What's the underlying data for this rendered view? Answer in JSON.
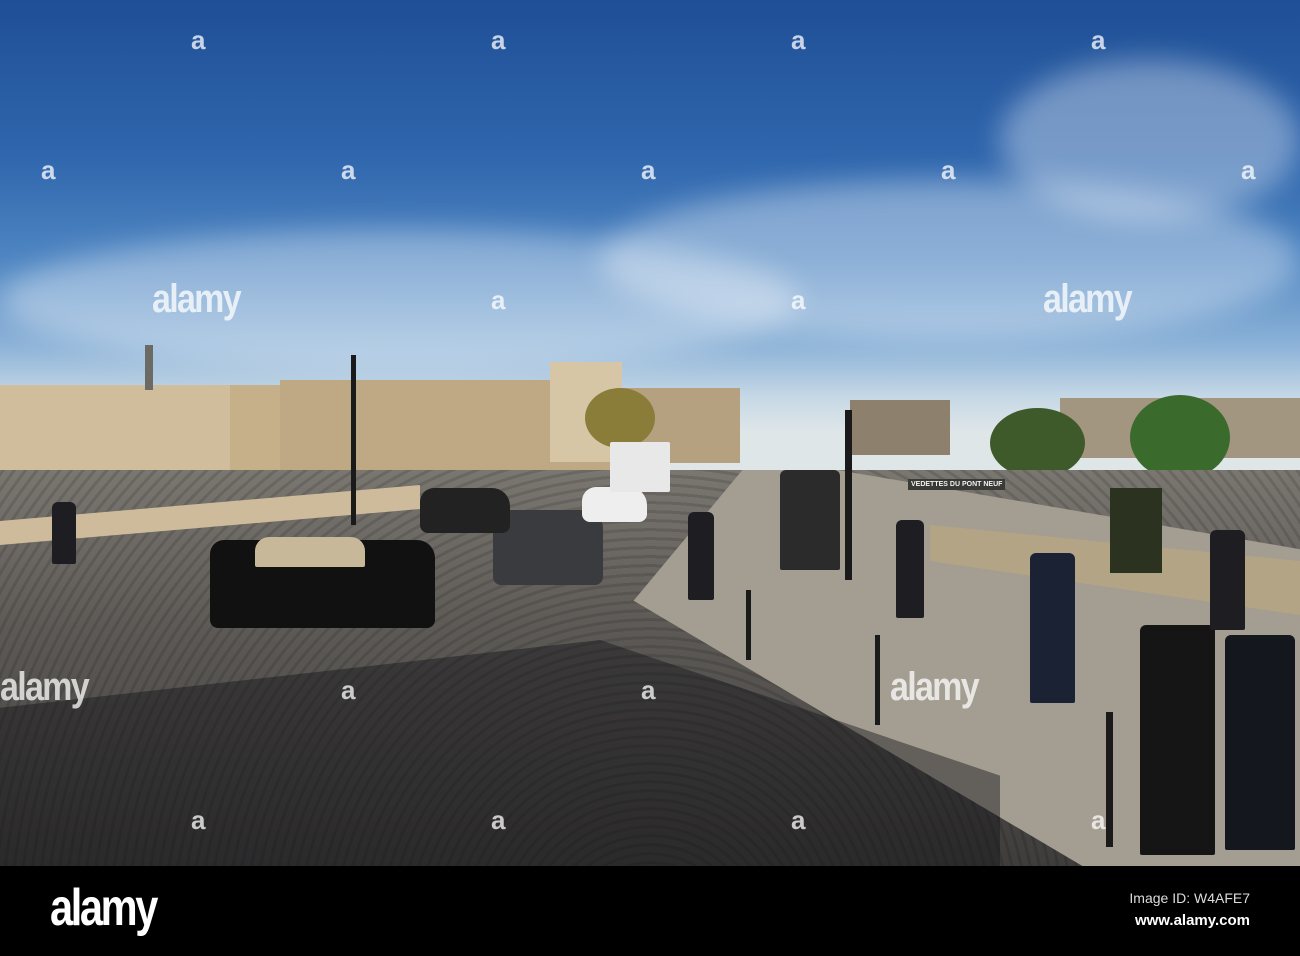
{
  "watermark": {
    "big": "alamy",
    "small": "a"
  },
  "sign": "VEDETTES DU PONT NEUF",
  "footer": {
    "logo": "alamy",
    "image_id": "Image ID: W4AFE7",
    "url": "www.alamy.com"
  }
}
